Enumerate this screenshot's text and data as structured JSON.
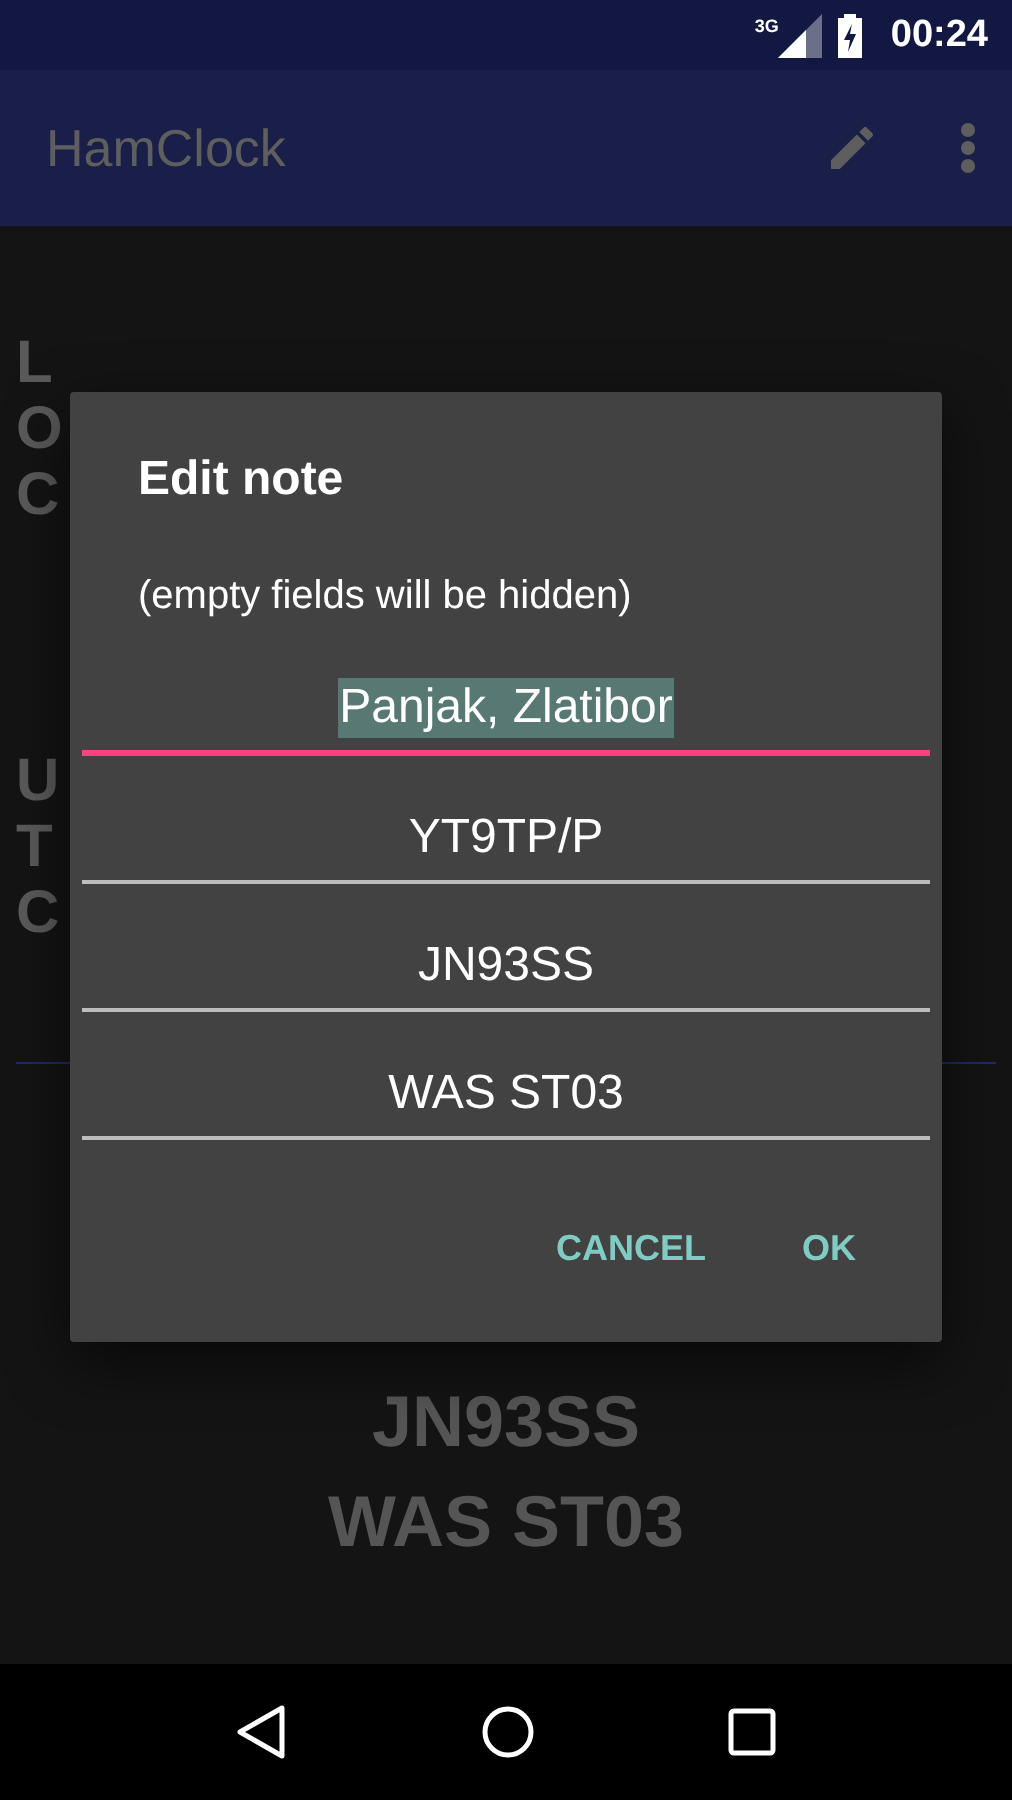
{
  "status_bar": {
    "network": "3G",
    "time": "00:24"
  },
  "app_bar": {
    "title": "HamClock"
  },
  "clock": {
    "local_label": "LOC",
    "utc_label": "UTC"
  },
  "notes": [
    "JN93SS",
    "WAS ST03"
  ],
  "dialog": {
    "title": "Edit note",
    "subtitle": "(empty fields will be hidden)",
    "fields": [
      {
        "value": "Panjak, Zlatibor",
        "focused": true
      },
      {
        "value": "YT9TP/P",
        "focused": false
      },
      {
        "value": "JN93SS",
        "focused": false
      },
      {
        "value": "WAS ST03",
        "focused": false
      }
    ],
    "buttons": [
      "CANCEL",
      "OK"
    ]
  }
}
